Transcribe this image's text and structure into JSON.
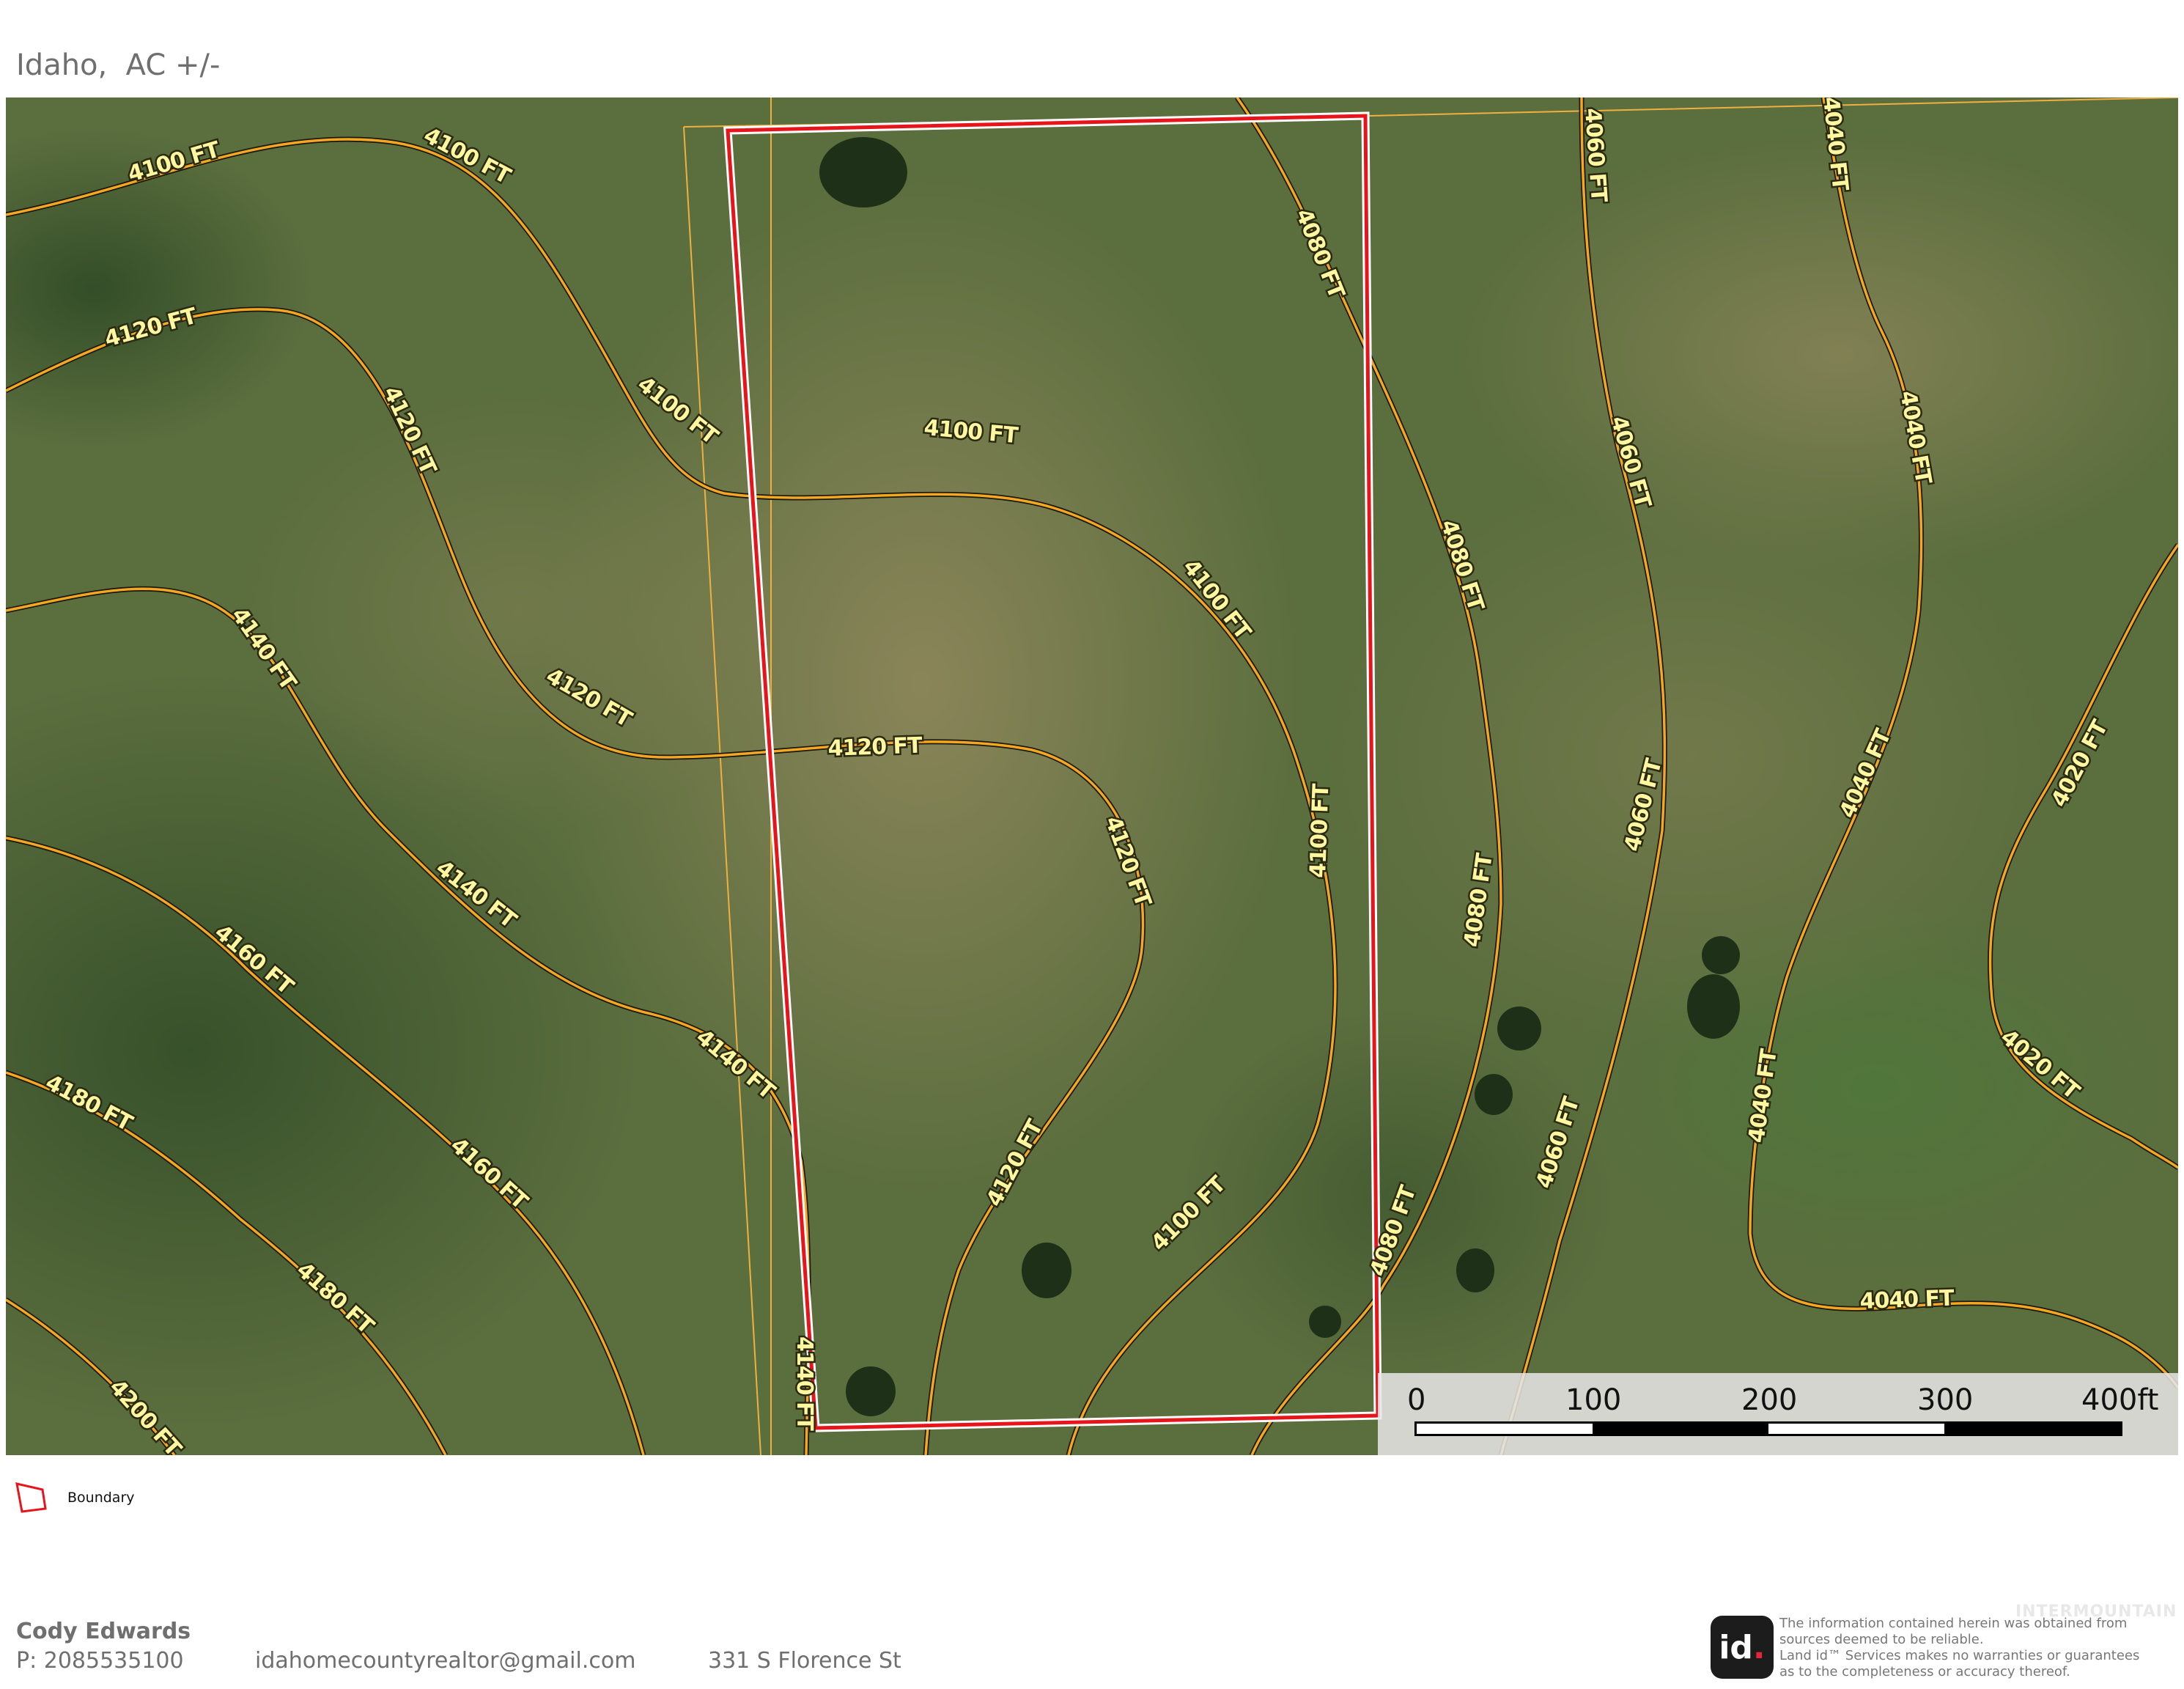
{
  "title": "Idaho,  AC +/-",
  "map": {
    "base": "satellite-imagery",
    "colors": {
      "boundary": "#e8141c",
      "contour": "#f5a623",
      "parcel_line": "#f0b040",
      "contour_label": "#fff7a0"
    },
    "contour_labels": [
      "4100 FT",
      "4100 FT",
      "4100 FT",
      "4100 FT",
      "4100 FT",
      "4100 FT",
      "4100 FT",
      "4120 FT",
      "4120 FT",
      "4120 FT",
      "4120 FT",
      "4120 FT",
      "4120 FT",
      "4140 FT",
      "4140 FT",
      "4140 FT",
      "4140 FT",
      "4160 FT",
      "4160 FT",
      "4180 FT",
      "4180 FT",
      "4200 FT",
      "4080 FT",
      "4080 FT",
      "4080 FT",
      "4080 FT",
      "4060 FT",
      "4060 FT",
      "4060 FT",
      "4060 FT",
      "4040 FT",
      "4040 FT",
      "4040 FT",
      "4040 FT",
      "4040 FT",
      "4020 FT",
      "4020 FT"
    ]
  },
  "scale_bar": {
    "labels": [
      "0",
      "100",
      "200",
      "300",
      "400ft"
    ]
  },
  "legend": {
    "icon": "boundary-polygon-icon",
    "label": "Boundary"
  },
  "footer": {
    "agent_name": "Cody Edwards",
    "phone": "P: 2085535100",
    "email": "idahomecountyrealtor@gmail.com",
    "address": "331 S Florence St",
    "logo_text": "id",
    "logo_dot": ".",
    "disclaimer": "The information contained herein was obtained from\nsources deemed to be reliable.\n  Land id™ Services makes no warranties or guarantees\nas to the completeness or accuracy thereof.",
    "watermark": "INTERMOUNTAIN"
  }
}
